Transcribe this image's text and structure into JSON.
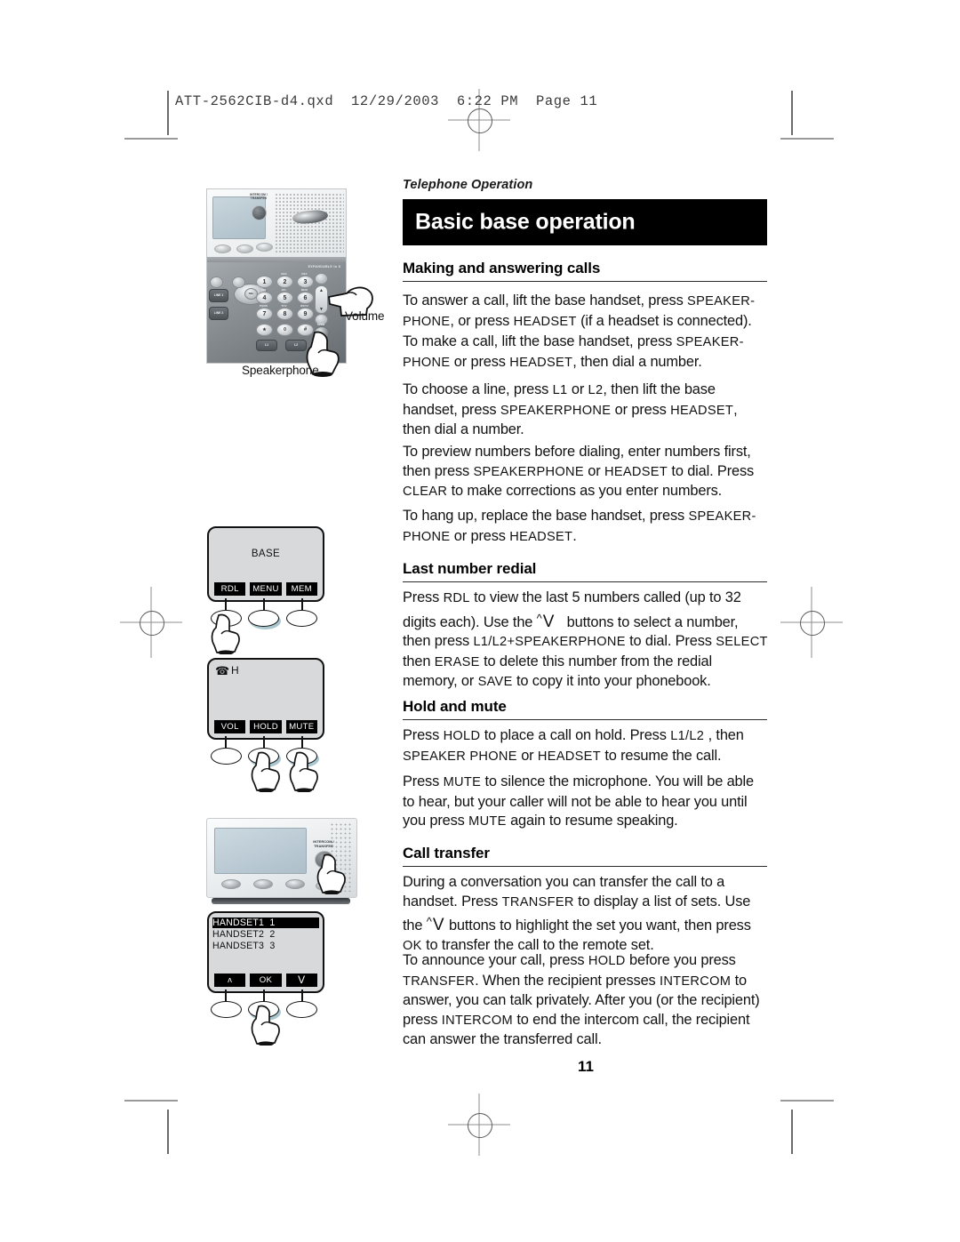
{
  "file_header": "ATT-2562CIB-d4.qxd  12/29/2003  6:22 PM  Page 11",
  "running_head": "Telephone Operation",
  "banner_title": "Basic base operation",
  "page_number": "11",
  "sections": [
    {
      "heading": "Making and answering calls",
      "paragraphs": [
        "To answer a call, lift the base handset, press SPEAKER-PHONE, or press HEADSET (if a headset is connected).",
        "To make a call, lift the base handset, press SPEAKER-PHONE or press HEADSET, then dial a number.",
        "To choose a line, press L1 or L2, then lift the base handset, press SPEAKERPHONE or press HEADSET, then dial a number.",
        "To preview numbers before dialing, enter numbers first, then press SPEAKERPHONE or HEADSET to dial. Press CLEAR to make corrections as you enter numbers.",
        "To hang up, replace the base handset, press SPEAKER-PHONE or press HEADSET."
      ]
    },
    {
      "heading": "Last number redial",
      "paragraphs": [
        "Press RDL to view the last 5 numbers called (up to 32 digits each). Use the ^V buttons to select a number, then press L1/L2+SPEAKERPHONE to dial. Press SELECT then ERASE to delete this number from the redial memory, or SAVE to copy it into your phonebook."
      ]
    },
    {
      "heading": "Hold and mute",
      "paragraphs": [
        "Press HOLD to place a call on hold. Press L1/L2 , then SPEAKER PHONE or HEADSET to resume the call.",
        "Press MUTE to silence the microphone. You will be able to hear, but your caller will not be able to hear you until you press MUTE again to resume speaking."
      ]
    },
    {
      "heading": "Call transfer",
      "paragraphs": [
        "During a conversation you can transfer the call to a handset. Press TRANSFER to display a list of sets. Use the ^V buttons to highlight the set you want, then press OK to transfer the call to the remote set.",
        "To announce your call, press HOLD before you press TRANSFER. When the recipient presses INTERCOM to answer, you can talk privately. After you (or the recipient) press INTERCOM to end the intercom call, the recipient can answer the transferred call."
      ]
    }
  ],
  "illustrations": {
    "phone_photo": {
      "callout_volume": "Volume",
      "callout_speakerphone": "Speakerphone",
      "brand": "EXPANDABLE to 8",
      "intercom_label": "INTERCOM / TRANSFER",
      "keypad": [
        {
          "digit": "1",
          "letters": ""
        },
        {
          "digit": "2",
          "letters": "ABC"
        },
        {
          "digit": "3",
          "letters": "DEF"
        },
        {
          "digit": "4",
          "letters": "GHI"
        },
        {
          "digit": "5",
          "letters": "JKL"
        },
        {
          "digit": "6",
          "letters": "MNO"
        },
        {
          "digit": "7",
          "letters": "PQRS"
        },
        {
          "digit": "8",
          "letters": "TUV"
        },
        {
          "digit": "9",
          "letters": "WXYZ"
        },
        {
          "digit": "★",
          "letters": "TONE"
        },
        {
          "digit": "0",
          "letters": "OPER"
        },
        {
          "digit": "#",
          "letters": ""
        }
      ],
      "line_keys": [
        "L1",
        "L2"
      ],
      "side_labels": [
        "REDIAL",
        "DELETE",
        "MUTE",
        "FLASH"
      ],
      "line_labels": [
        "LINE 1",
        "LINE 2"
      ],
      "volume_arrows": [
        "▲",
        "▼"
      ]
    },
    "base_display": {
      "screen_text": "BASE",
      "softkeys": [
        "RDL",
        "MENU",
        "MEM"
      ],
      "pressed": "RDL"
    },
    "hold_display": {
      "screen_icon": "phone-icon",
      "screen_text": "H",
      "softkeys": [
        "VOL",
        "HOLD",
        "MUTE"
      ],
      "pressed": [
        "HOLD",
        "MUTE"
      ]
    },
    "base_top": {
      "button_label": "INTERCOM / TRANSFER"
    },
    "handset_list": {
      "rows": [
        {
          "name": "HANDSET1",
          "num": "1",
          "selected": true
        },
        {
          "name": "HANDSET2",
          "num": "2",
          "selected": false
        },
        {
          "name": "HANDSET3",
          "num": "3",
          "selected": false
        }
      ],
      "softkeys": [
        "ʌ",
        "OK",
        "V"
      ],
      "pressed": "OK"
    }
  }
}
